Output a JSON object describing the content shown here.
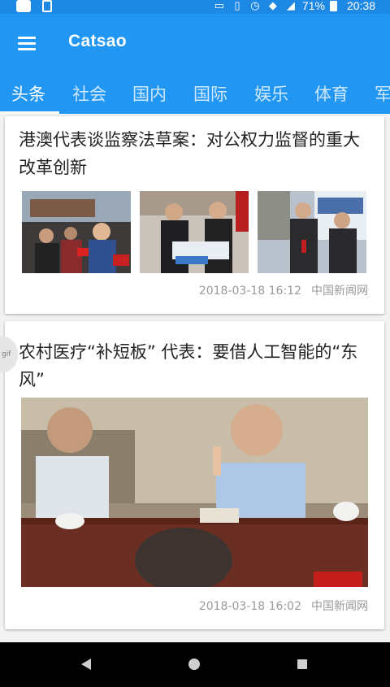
{
  "status_bar": {
    "battery": "71%",
    "time": "20:38",
    "icons": [
      "notification-square-icon",
      "sim-alert-icon",
      "cast-icon",
      "vibrate-icon",
      "alarm-icon",
      "wifi-off-icon",
      "no-signal-icon",
      "battery-icon"
    ]
  },
  "app": {
    "title": "Catsao"
  },
  "tabs": [
    {
      "label": "头条",
      "active": true
    },
    {
      "label": "社会"
    },
    {
      "label": "国内"
    },
    {
      "label": "国际"
    },
    {
      "label": "娱乐"
    },
    {
      "label": "体育"
    },
    {
      "label": "军"
    }
  ],
  "articles": [
    {
      "title": "港澳代表谈监察法草案：对公权力监督的重大改革创新",
      "date": "2018-03-18 16:12",
      "source": "中国新闻网",
      "images": [
        "press-interview-photo",
        "delegates-handshake-photo",
        "delegates-walking-photo"
      ]
    },
    {
      "title": "农村医疗“补短板” 代表：要借人工智能的“东风”",
      "date": "2018-03-18 16:02",
      "source": "中国新闻网",
      "images": [
        "delegate-speaking-photo"
      ]
    }
  ],
  "gif_badge": "gif",
  "colors": {
    "primary": "#2196f3",
    "status_bar": "#1e88e5",
    "card": "#ffffff",
    "meta_text": "#9a9a9a"
  }
}
